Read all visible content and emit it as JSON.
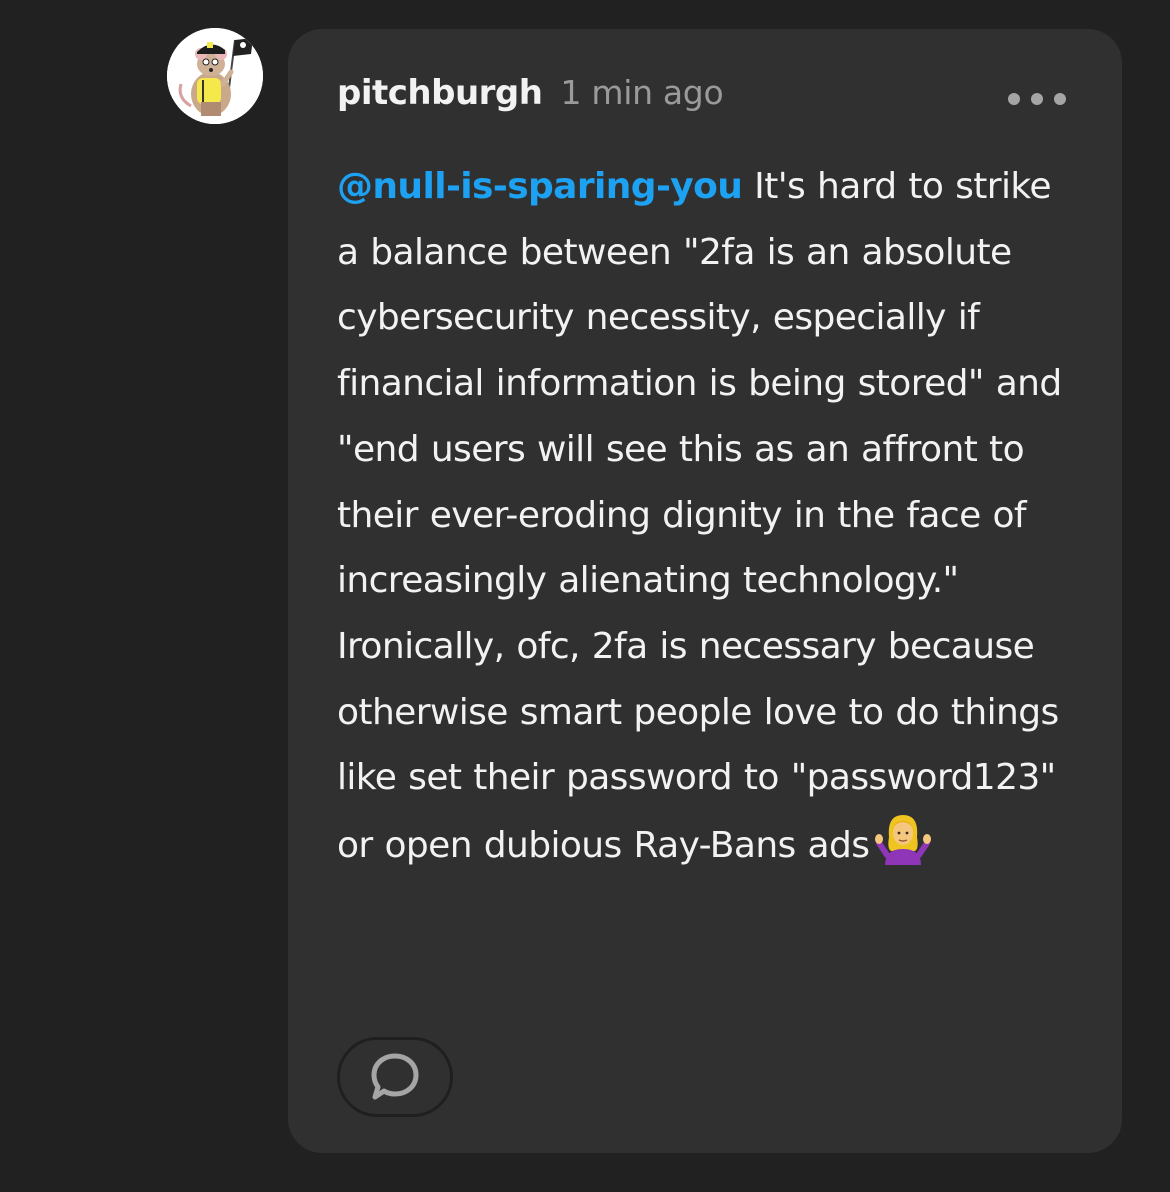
{
  "post": {
    "username": "pitchburgh",
    "timestamp": "1 min ago",
    "mention": "@null-is-sparing-you",
    "body_text": " It's hard to strike a balance between \"2fa is an absolute cybersecurity necessity, especially if financial information is being stored\" and \"end users will see this as an affront to their ever-eroding dignity in the face of increasingly alienating technology.\" Ironically, ofc, 2fa is necessary because otherwise smart people love to do things like set their password to \"password123\" or open dubious Ray-Bans ads",
    "emoji": "person-shrugging-emoji"
  },
  "icons": {
    "avatar": "rat-pirate-avatar",
    "more": "more-options-icon",
    "reply": "speech-bubble-icon"
  },
  "colors": {
    "background": "#212121",
    "card": "#303030",
    "mention": "#1da1f2",
    "text": "#f2f2f2",
    "muted": "#9a9a9a"
  }
}
